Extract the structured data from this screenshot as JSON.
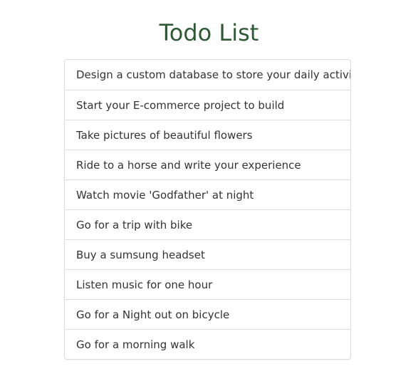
{
  "page": {
    "title": "Todo List",
    "title_color": "#2e5a33"
  },
  "todos": [
    {
      "label": "Design a custom database to store your daily activity"
    },
    {
      "label": "Start your E-commerce project to build"
    },
    {
      "label": "Take pictures of beautiful flowers"
    },
    {
      "label": "Ride to a horse and write your experience"
    },
    {
      "label": "Watch movie 'Godfather' at night"
    },
    {
      "label": "Go for a trip with bike"
    },
    {
      "label": "Buy a sumsung headset"
    },
    {
      "label": "Listen music for one hour"
    },
    {
      "label": "Go for a Night out on bicycle"
    },
    {
      "label": "Go for a morning walk"
    }
  ]
}
